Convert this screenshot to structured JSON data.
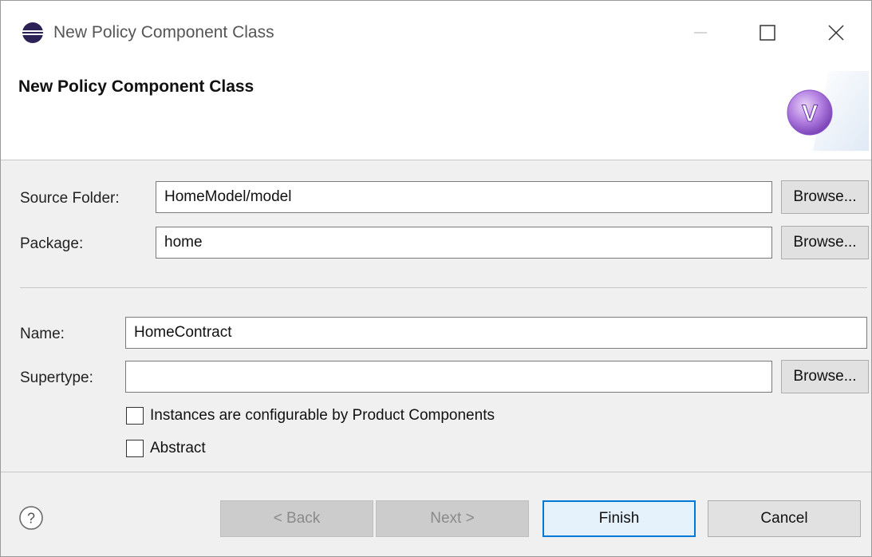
{
  "window": {
    "title": "New Policy Component Class"
  },
  "banner": {
    "heading": "New Policy Component Class"
  },
  "form": {
    "source_folder": {
      "label": "Source Folder:",
      "value": "HomeModel/model",
      "browse": "Browse..."
    },
    "package": {
      "label": "Package:",
      "value": "home",
      "browse": "Browse..."
    },
    "name": {
      "label": "Name:",
      "value": "HomeContract"
    },
    "supertype": {
      "label": "Supertype:",
      "value": "",
      "browse": "Browse..."
    },
    "configurable": {
      "label": "Instances are configurable by Product Components",
      "checked": false
    },
    "abstract": {
      "label": "Abstract",
      "checked": false
    }
  },
  "footer": {
    "back": "< Back",
    "next": "Next >",
    "finish": "Finish",
    "cancel": "Cancel"
  },
  "colors": {
    "accent": "#0078d7",
    "wizard_icon": "#9b59d0"
  }
}
